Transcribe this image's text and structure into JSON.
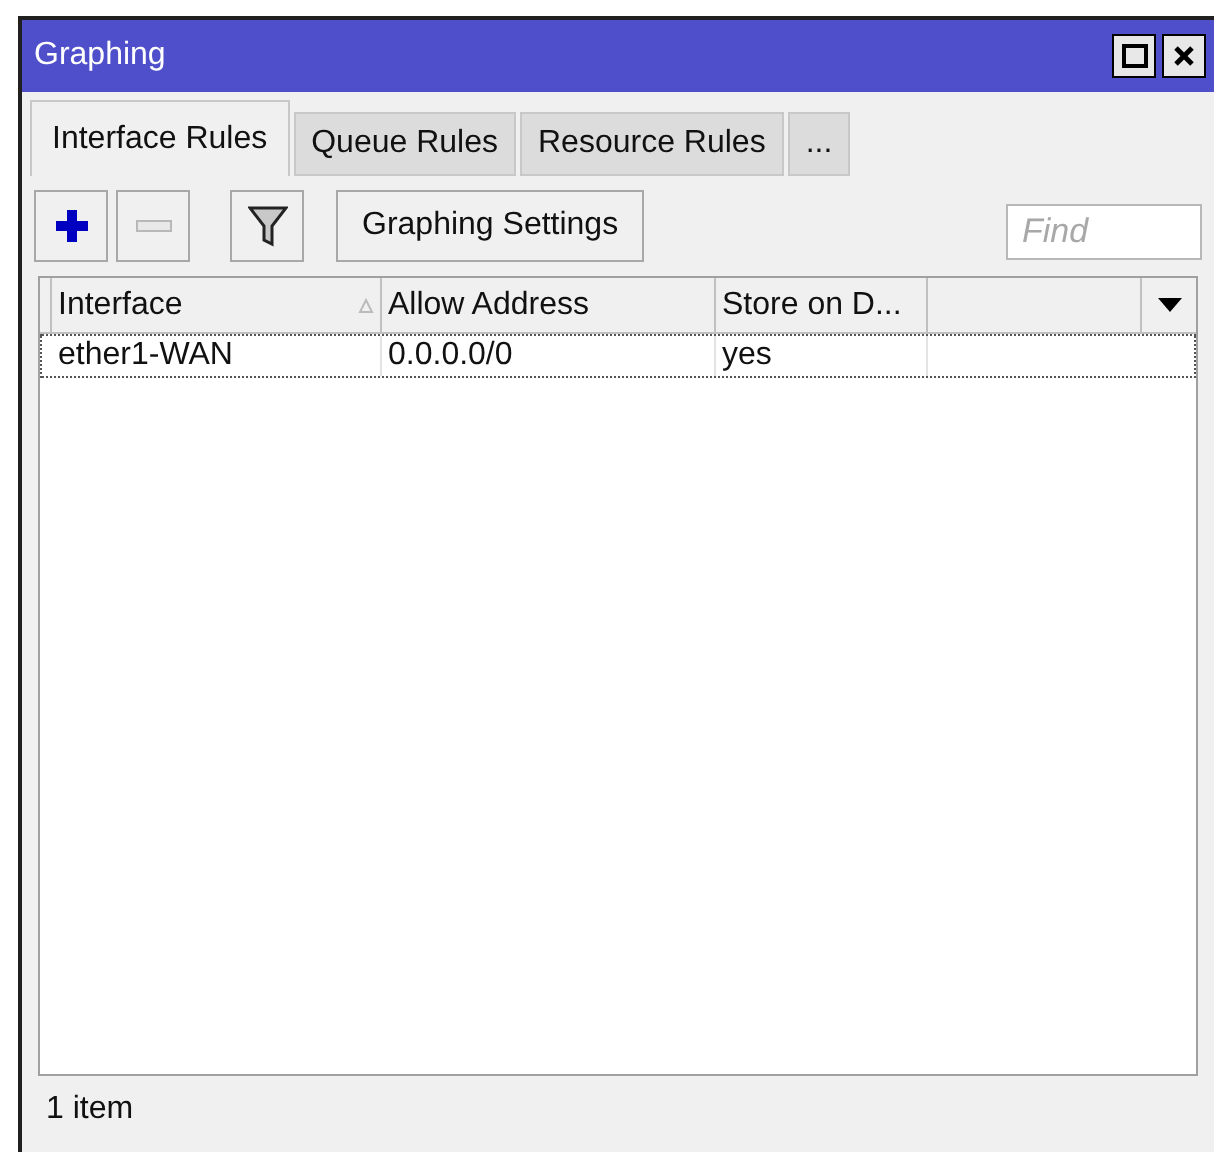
{
  "window": {
    "title": "Graphing"
  },
  "tabs": [
    {
      "label": "Interface Rules",
      "selected": true
    },
    {
      "label": "Queue Rules",
      "selected": false
    },
    {
      "label": "Resource Rules",
      "selected": false
    },
    {
      "label": "...",
      "selected": false
    }
  ],
  "toolbar": {
    "add_disabled": false,
    "remove_disabled": true,
    "settings_button": "Graphing Settings",
    "find": {
      "placeholder": "Find"
    }
  },
  "table": {
    "columns": [
      {
        "label": "Interface",
        "sorted": true
      },
      {
        "label": "Allow Address",
        "sorted": false
      },
      {
        "label": "Store on D...",
        "sorted": false
      }
    ],
    "rows": [
      {
        "cells": [
          "ether1-WAN",
          "0.0.0.0/0",
          "yes"
        ],
        "selected": true
      }
    ]
  },
  "status_bar": "1 item"
}
